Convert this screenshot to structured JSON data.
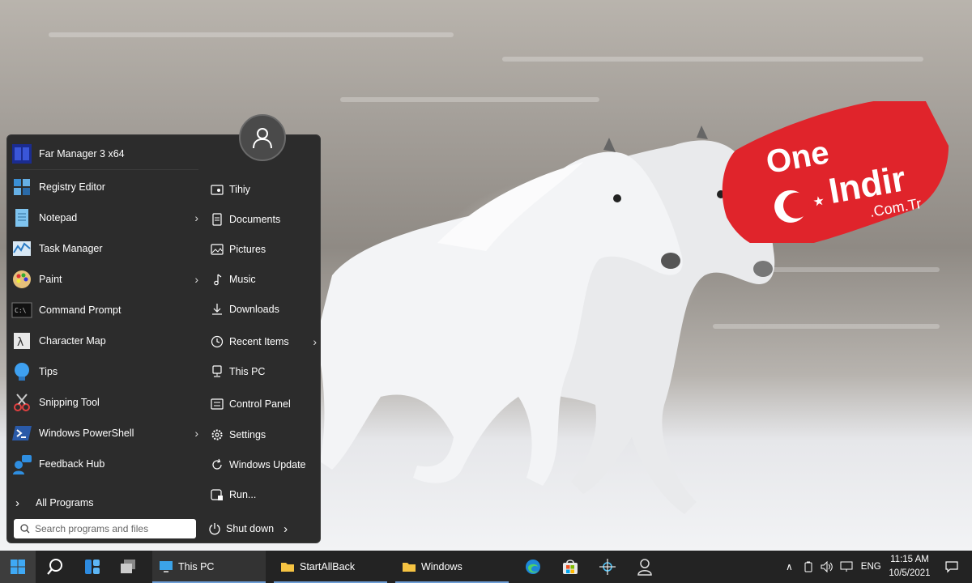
{
  "start_menu": {
    "pinned": [
      {
        "label": "Far Manager 3 x64",
        "icon": "far-manager-icon",
        "arrow": false
      },
      {
        "label": "Registry Editor",
        "icon": "registry-editor-icon",
        "arrow": false
      },
      {
        "label": "Notepad",
        "icon": "notepad-icon",
        "arrow": true
      },
      {
        "label": "Task Manager",
        "icon": "task-manager-icon",
        "arrow": false
      },
      {
        "label": "Paint",
        "icon": "paint-icon",
        "arrow": true
      },
      {
        "label": "Command Prompt",
        "icon": "command-prompt-icon",
        "arrow": false
      },
      {
        "label": "Character Map",
        "icon": "character-map-icon",
        "arrow": false
      },
      {
        "label": "Tips",
        "icon": "tips-icon",
        "arrow": false
      },
      {
        "label": "Snipping Tool",
        "icon": "snipping-tool-icon",
        "arrow": false
      },
      {
        "label": "Windows PowerShell",
        "icon": "powershell-icon",
        "arrow": true
      },
      {
        "label": "Feedback Hub",
        "icon": "feedback-hub-icon",
        "arrow": false
      }
    ],
    "all_programs_label": "All Programs",
    "search_placeholder": "Search programs and files",
    "places": [
      {
        "label": "Tihiy",
        "icon": "user-folder-icon",
        "arrow": false
      },
      {
        "label": "Documents",
        "icon": "document-icon",
        "arrow": false
      },
      {
        "label": "Pictures",
        "icon": "picture-icon",
        "arrow": false
      },
      {
        "label": "Music",
        "icon": "music-icon",
        "arrow": false
      },
      {
        "label": "Downloads",
        "icon": "download-icon",
        "arrow": false
      },
      {
        "label": "Recent Items",
        "icon": "clock-icon",
        "arrow": true
      },
      {
        "label": "This PC",
        "icon": "computer-icon",
        "arrow": false
      },
      {
        "label": "Control Panel",
        "icon": "control-panel-icon",
        "arrow": false
      },
      {
        "label": "Settings",
        "icon": "gear-icon",
        "arrow": false
      },
      {
        "label": "Windows Update",
        "icon": "update-icon",
        "arrow": false
      },
      {
        "label": "Run...",
        "icon": "run-icon",
        "arrow": false
      }
    ],
    "shutdown_label": "Shut down"
  },
  "logo": {
    "line1": "One",
    "line2": "Indir",
    "line3": ".Com.Tr",
    "color": "#e0242b"
  },
  "taskbar": {
    "apps": [
      {
        "label": "This PC",
        "icon": "computer-icon"
      },
      {
        "label": "StartAllBack",
        "icon": "folder-icon"
      },
      {
        "label": "Windows",
        "icon": "folder-icon"
      }
    ],
    "language": "ENG",
    "time": "11:15 AM",
    "date": "10/5/2021"
  },
  "colors": {
    "menu_bg": "#2c2c2c",
    "taskbar_bg": "#232323",
    "accent": "#0078d4"
  }
}
